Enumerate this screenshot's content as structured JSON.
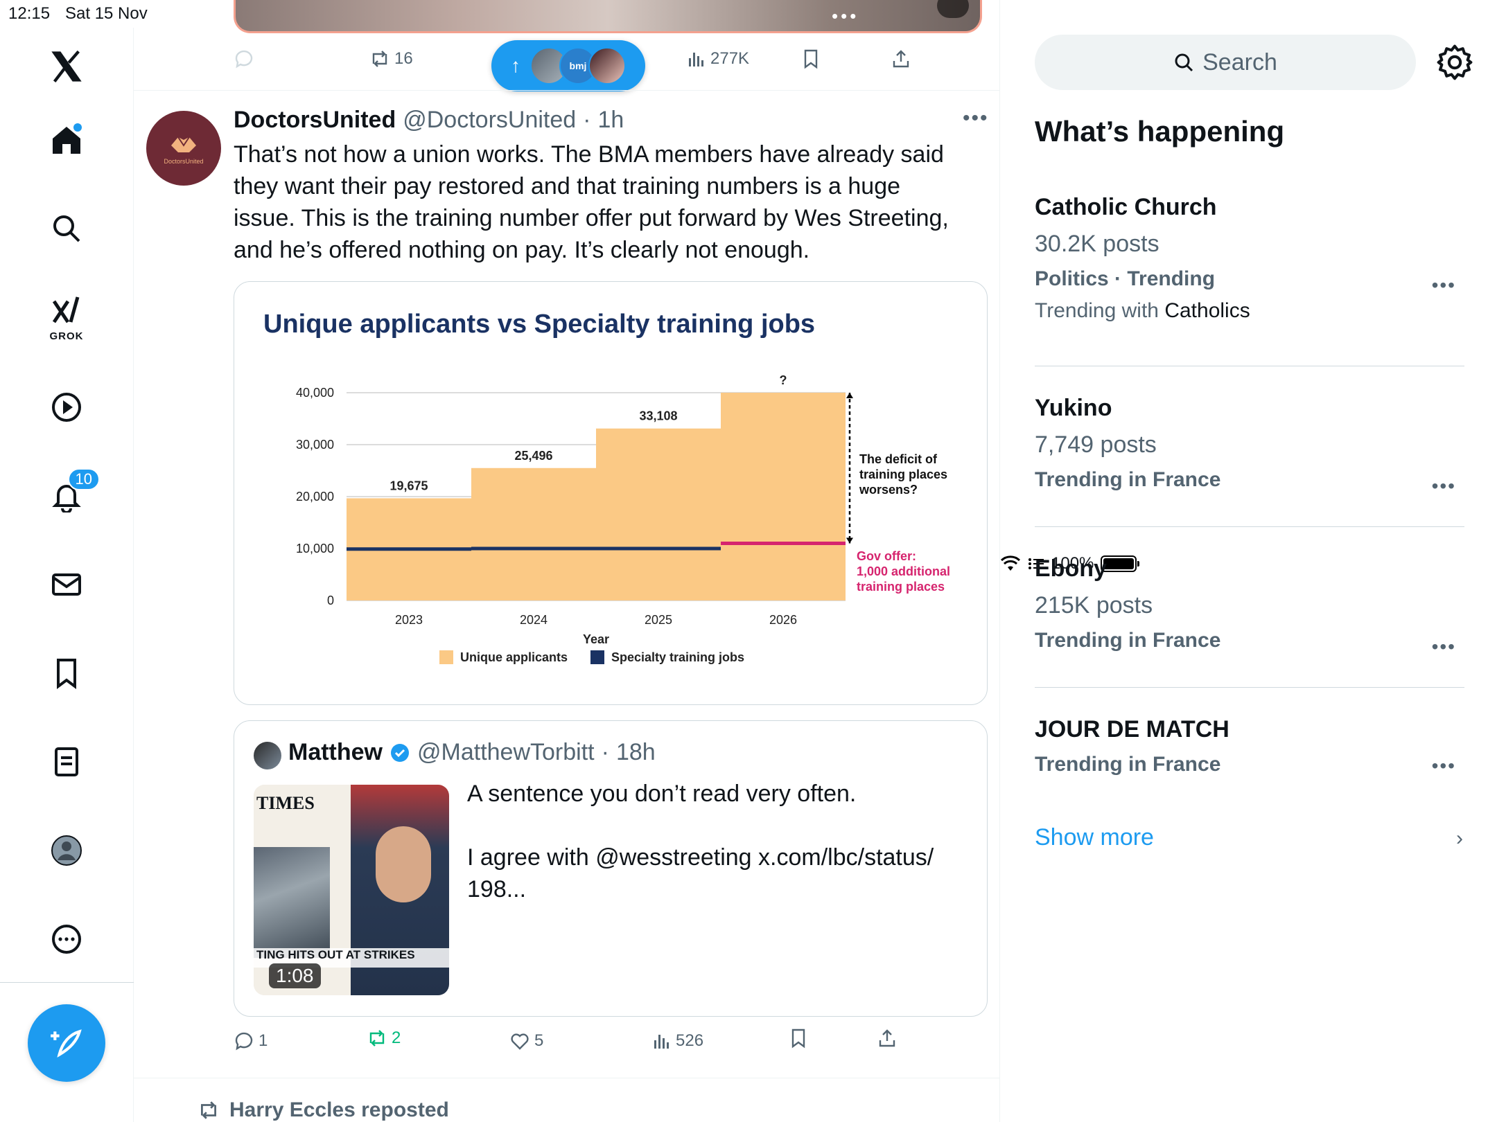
{
  "status_bar": {
    "time": "12:15",
    "date": "Sat 15 Nov",
    "battery": "100%"
  },
  "nav": {
    "grok_label": "GROK",
    "notifications_badge": "10"
  },
  "top_post": {
    "reposts": "16",
    "views": "277K"
  },
  "new_posts_pill": {
    "avatar_2_text": "bmj"
  },
  "post": {
    "author_name": "DoctorsUnited",
    "author_handle": "@DoctorsUnited",
    "separator": "·",
    "time_ago": "1h",
    "avatar_text": "DoctorsUnited",
    "text": "That’s not how a union works. The BMA members have already said they want their pay restored and that training numbers is a huge issue. This is the training number offer put forward by Wes Streeting, and he’s offered nothing on pay. It’s clearly not enough.",
    "stats": {
      "replies": "1",
      "reposts": "2",
      "likes": "5",
      "views": "526"
    }
  },
  "chart_data": {
    "type": "bar",
    "title": "Unique applicants vs Specialty training jobs",
    "xlabel": "Year",
    "ylabel": "",
    "categories": [
      "2023",
      "2024",
      "2025",
      "2026"
    ],
    "ylim": [
      0,
      40000
    ],
    "yticks": [
      "0",
      "10,000",
      "20,000",
      "30,000",
      "40,000"
    ],
    "series": [
      {
        "name": "Unique applicants",
        "values": [
          19675,
          25496,
          33108,
          40000
        ],
        "labels": [
          "19,675",
          "25,496",
          "33,108",
          "?"
        ],
        "color": "#fbc985"
      },
      {
        "name": "Specialty training jobs",
        "values": [
          9900,
          10000,
          10000,
          11000
        ],
        "color": "#1a3263"
      }
    ],
    "annotations": {
      "deficit": [
        "The deficit of",
        "training places",
        "worsens?"
      ],
      "gov_offer": [
        "Gov offer:",
        "1,000 additional",
        "training places"
      ],
      "gov_color": "#d6246e"
    },
    "legend_position": "bottom",
    "grid": true
  },
  "quote": {
    "name": "Matthew",
    "handle": "@MatthewTorbitt",
    "separator": "·",
    "time_ago": "18h",
    "text": "A sentence you don’t read very often.\n\nI agree with @wesstreeting x.com/lbc/status/\n198...",
    "thumb_masthead": "TIMES",
    "thumb_banner": "TING HITS OUT AT STRIKES",
    "duration": "1:08"
  },
  "reposted_by": "Harry Eccles reposted",
  "sidebar": {
    "search_placeholder": "Search",
    "heading": "What’s happening",
    "trends": [
      {
        "title": "Catholic Church",
        "posts": "30.2K posts",
        "meta": "Politics · Trending",
        "extra_prefix": "Trending with",
        "extra_name": "Catholics"
      },
      {
        "title": "Yukino",
        "posts": "7,749 posts",
        "meta": "Trending in France"
      },
      {
        "title": "Ebony",
        "posts": "215K posts",
        "meta": "Trending in France"
      },
      {
        "title": "JOUR DE MATCH",
        "meta": "Trending in France"
      }
    ],
    "show_more": "Show more"
  },
  "colors": {
    "accent": "#1d9bf0",
    "text": "#0f1419",
    "secondary": "#536471",
    "repost_green": "#00ba7c"
  }
}
